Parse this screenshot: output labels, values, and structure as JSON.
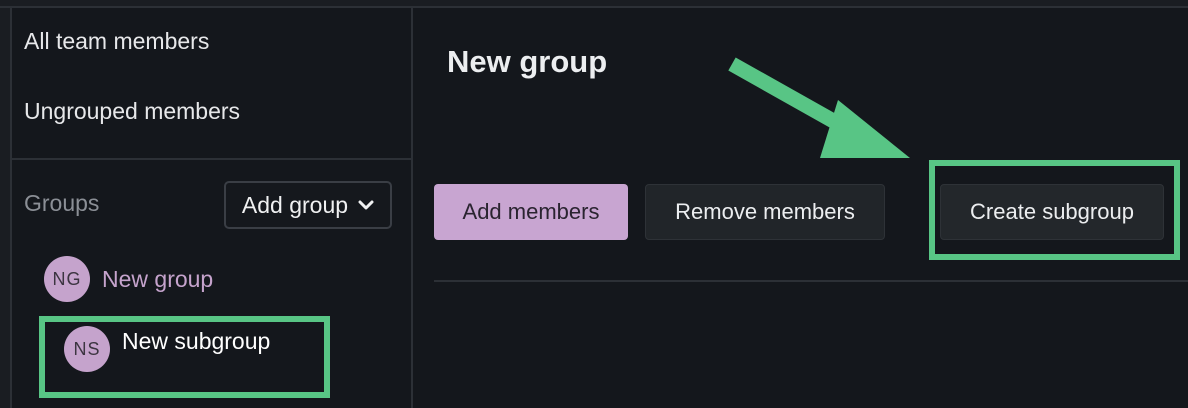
{
  "sidebar": {
    "nav": {
      "all_members": "All team members",
      "ungrouped_members": "Ungrouped members"
    },
    "groups_label": "Groups",
    "add_group_label": "Add group",
    "groups": [
      {
        "initials": "NG",
        "name": "New group",
        "color": "#c5a3cc"
      },
      {
        "initials": "NS",
        "name": "New subgroup",
        "color": "#ffffff"
      }
    ]
  },
  "main": {
    "title": "New group",
    "buttons": {
      "add_members": "Add members",
      "remove_members": "Remove members",
      "create_subgroup": "Create subgroup"
    }
  },
  "annotations": {
    "highlight_color": "#58c585",
    "arrow_color": "#58c585"
  },
  "colors": {
    "background": "#14171c",
    "accent": "#c8a5d1"
  }
}
